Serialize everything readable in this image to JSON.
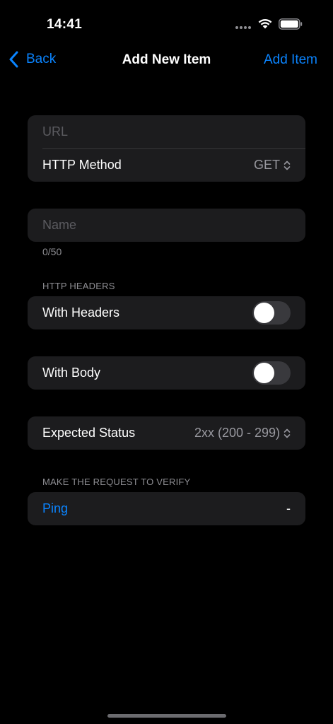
{
  "status_bar": {
    "time": "14:41",
    "icons": [
      "wifi-icon",
      "battery-icon"
    ]
  },
  "nav": {
    "back_label": "Back",
    "title": "Add New Item",
    "action_label": "Add Item",
    "accent_color": "#0a84ff"
  },
  "request_group": {
    "url_placeholder": "URL",
    "method_label": "HTTP Method",
    "method_value": "GET"
  },
  "name_group": {
    "name_placeholder": "Name",
    "counter": "0/50"
  },
  "headers_section": {
    "header": "HTTP HEADERS",
    "with_headers_label": "With Headers",
    "with_headers_on": false
  },
  "body_group": {
    "with_body_label": "With Body",
    "with_body_on": false
  },
  "status_group": {
    "expected_status_label": "Expected Status",
    "expected_status_value": "2xx (200 - 299)"
  },
  "verify_section": {
    "header": "MAKE THE REQUEST TO VERIFY",
    "ping_label": "Ping",
    "ping_result": "-"
  }
}
